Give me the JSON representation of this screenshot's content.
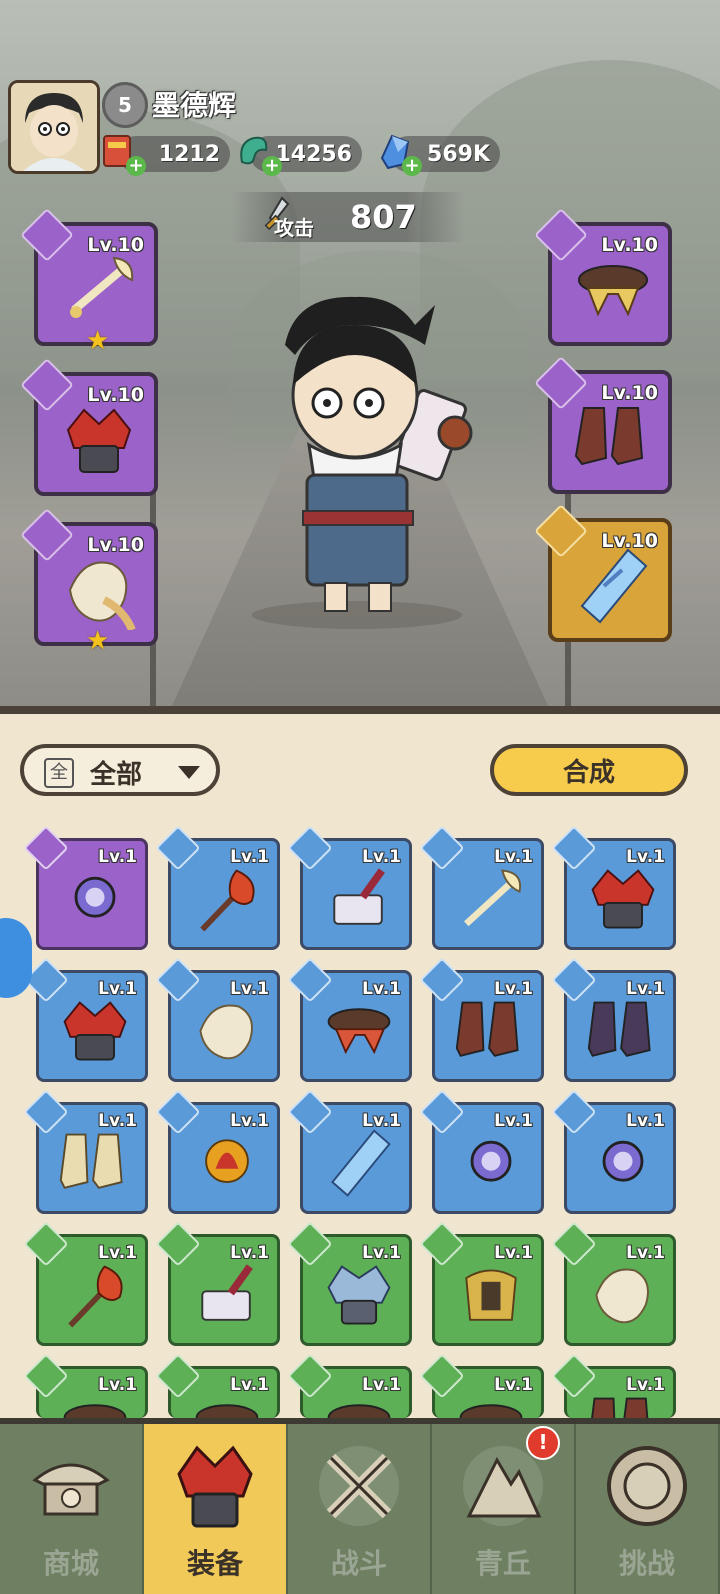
{
  "player": {
    "level": "5",
    "name": "墨德辉"
  },
  "resources": [
    {
      "icon": "scroll-ticket-icon",
      "value": "1212"
    },
    {
      "icon": "jade-dragon-icon",
      "value": "14256"
    },
    {
      "icon": "blue-crystal-icon",
      "value": "569K"
    }
  ],
  "attack": {
    "label": "攻击",
    "value": "807"
  },
  "equipped": {
    "left": [
      {
        "icon": "fan-weapon-icon",
        "level": "Lv.10",
        "rarity": "purple",
        "star": "★"
      },
      {
        "icon": "red-helmet-icon",
        "level": "Lv.10",
        "rarity": "purple",
        "star": ""
      },
      {
        "icon": "fur-cape-icon",
        "level": "Lv.10",
        "rarity": "purple",
        "star": "★"
      }
    ],
    "right": [
      {
        "icon": "belt-icon",
        "level": "Lv.10",
        "rarity": "purple",
        "star": ""
      },
      {
        "icon": "boots-icon",
        "level": "Lv.10",
        "rarity": "purple",
        "star": ""
      },
      {
        "icon": "crystal-pendant-icon",
        "level": "Lv.10",
        "rarity": "gold",
        "star": ""
      }
    ]
  },
  "filter": {
    "box": "全",
    "label": "全部"
  },
  "combine_label": "合成",
  "inventory": [
    {
      "icon": "orb-amulet-icon",
      "level": "Lv.1",
      "rarity": "purple"
    },
    {
      "icon": "flame-staff-icon",
      "level": "Lv.1",
      "rarity": "blue"
    },
    {
      "icon": "stone-hammer-icon",
      "level": "Lv.1",
      "rarity": "blue"
    },
    {
      "icon": "fan-weapon-icon",
      "level": "Lv.1",
      "rarity": "blue"
    },
    {
      "icon": "red-helmet-icon",
      "level": "Lv.1",
      "rarity": "blue"
    },
    {
      "icon": "red-helmet-icon",
      "level": "Lv.1",
      "rarity": "blue"
    },
    {
      "icon": "fur-cape-icon",
      "level": "Lv.1",
      "rarity": "blue"
    },
    {
      "icon": "belt-icon",
      "level": "Lv.1",
      "rarity": "blue"
    },
    {
      "icon": "boots-icon",
      "level": "Lv.1",
      "rarity": "blue"
    },
    {
      "icon": "dark-boots-icon",
      "level": "Lv.1",
      "rarity": "blue"
    },
    {
      "icon": "bone-boots-icon",
      "level": "Lv.1",
      "rarity": "blue"
    },
    {
      "icon": "fire-orb-icon",
      "level": "Lv.1",
      "rarity": "blue"
    },
    {
      "icon": "crystal-pendant-icon",
      "level": "Lv.1",
      "rarity": "blue"
    },
    {
      "icon": "orb-amulet-icon",
      "level": "Lv.1",
      "rarity": "blue"
    },
    {
      "icon": "orb-amulet-icon",
      "level": "Lv.1",
      "rarity": "blue"
    },
    {
      "icon": "flame-staff-icon",
      "level": "Lv.1",
      "rarity": "green"
    },
    {
      "icon": "stone-hammer-icon",
      "level": "Lv.1",
      "rarity": "green"
    },
    {
      "icon": "ice-helmet-icon",
      "level": "Lv.1",
      "rarity": "green"
    },
    {
      "icon": "gold-armor-icon",
      "level": "Lv.1",
      "rarity": "green"
    },
    {
      "icon": "fur-cape-icon",
      "level": "Lv.1",
      "rarity": "green"
    },
    {
      "icon": "belt-icon",
      "level": "Lv.1",
      "rarity": "green"
    },
    {
      "icon": "belt-icon",
      "level": "Lv.1",
      "rarity": "green"
    },
    {
      "icon": "belt-icon",
      "level": "Lv.1",
      "rarity": "green"
    },
    {
      "icon": "belt-icon",
      "level": "Lv.1",
      "rarity": "green"
    },
    {
      "icon": "boots-icon",
      "level": "Lv.1",
      "rarity": "green"
    }
  ],
  "nav": [
    {
      "label": "商城",
      "icon": "shop-icon",
      "active": false,
      "alert": ""
    },
    {
      "label": "装备",
      "icon": "equipment-helmet-icon",
      "active": true,
      "alert": ""
    },
    {
      "label": "战斗",
      "icon": "crossed-swords-icon",
      "active": false,
      "alert": ""
    },
    {
      "label": "青丘",
      "icon": "mountain-icon",
      "active": false,
      "alert": "!"
    },
    {
      "label": "挑战",
      "icon": "challenge-orb-icon",
      "active": false,
      "alert": ""
    }
  ]
}
